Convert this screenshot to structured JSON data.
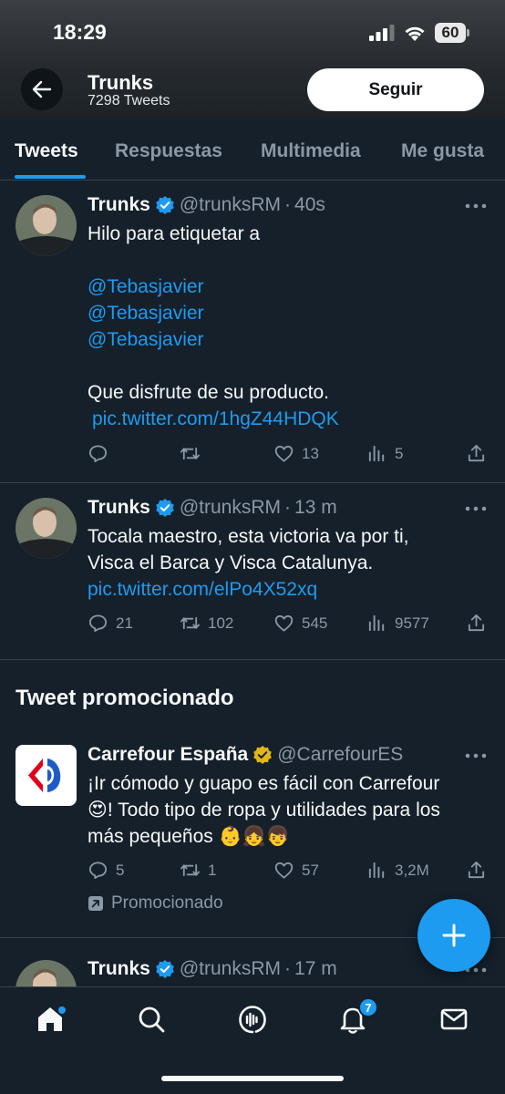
{
  "status_bar": {
    "time": "18:29",
    "battery": "60"
  },
  "header": {
    "name": "Trunks",
    "tweet_count": "7298 Tweets",
    "follow_label": "Seguir"
  },
  "tabs": [
    {
      "label": "Tweets",
      "active": true
    },
    {
      "label": "Respuestas",
      "active": false
    },
    {
      "label": "Multimedia",
      "active": false
    },
    {
      "label": "Me gusta",
      "active": false
    }
  ],
  "tweets": [
    {
      "name": "Trunks",
      "handle": "@trunksRM",
      "dot": "·",
      "time": "40s",
      "line1": "Hilo para etiquetar a",
      "mentions": [
        "@Tebasjavier",
        "@Tebasjavier",
        "@Tebasjavier"
      ],
      "line2": "Que disfrute de su producto.",
      "link": "pic.twitter.com/1hgZ44HDQK",
      "replies": "",
      "retweets": "",
      "likes": "13",
      "views": "5"
    },
    {
      "name": "Trunks",
      "handle": "@trunksRM",
      "dot": "·",
      "time": "13 m",
      "line1": "Tocala maestro, esta victoria va por ti,",
      "line2": "Visca el Barca y Visca Catalunya.",
      "link": "pic.twitter.com/elPo4X52xq",
      "replies": "21",
      "retweets": "102",
      "likes": "545",
      "views": "9577"
    },
    {
      "name": "Trunks",
      "handle": "@trunksRM",
      "dot": "·",
      "time": "17 m"
    }
  ],
  "promo": {
    "section_title": "Tweet promocionado",
    "name": "Carrefour España",
    "handle": "@CarrefourES",
    "line1": "¡Ir cómodo y guapo es fácil con Carrefour",
    "line2": "😍! Todo tipo de ropa y utilidades para los",
    "line3": "más pequeños 👶👧👦",
    "replies": "5",
    "retweets": "1",
    "likes": "57",
    "views": "3,2M",
    "promoted_label": "Promocionado"
  },
  "nav": {
    "notifications_badge": "7"
  },
  "colors": {
    "background": "#15202b",
    "accent": "#1d9bf0",
    "muted": "#8b98a5",
    "gold_verified": "#e2b719"
  }
}
